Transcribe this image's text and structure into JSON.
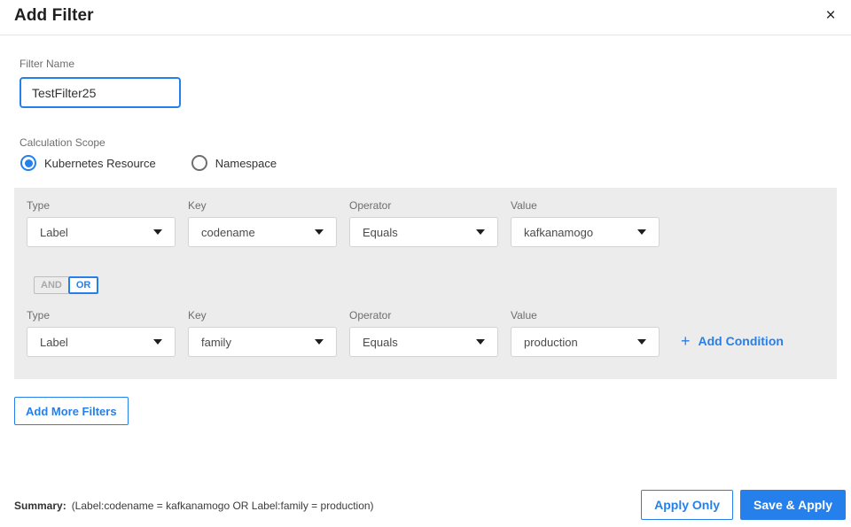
{
  "header": {
    "title": "Add Filter",
    "close_icon": "×"
  },
  "filter_name": {
    "label": "Filter Name",
    "value": "TestFilter25"
  },
  "calculation_scope": {
    "label": "Calculation Scope",
    "options": [
      {
        "label": "Kubernetes Resource",
        "selected": true
      },
      {
        "label": "Namespace",
        "selected": false
      }
    ]
  },
  "conditions": {
    "columns": [
      "Type",
      "Key",
      "Operator",
      "Value"
    ],
    "rows": [
      {
        "type": "Label",
        "key": "codename",
        "operator": "Equals",
        "value": "kafkanamogo"
      },
      {
        "type": "Label",
        "key": "family",
        "operator": "Equals",
        "value": "production"
      }
    ],
    "logic_toggle": {
      "and_label": "AND",
      "or_label": "OR",
      "selected": "OR"
    },
    "add_condition": {
      "icon": "+",
      "label": "Add Condition"
    }
  },
  "add_more_filters_label": "Add More Filters",
  "footer": {
    "summary_label": "Summary:",
    "summary_text": "(Label:codename = kafkanamogo OR Label:family = production)",
    "apply_only_label": "Apply Only",
    "save_apply_label": "Save & Apply"
  },
  "colors": {
    "accent": "#2680eb",
    "panel_bg": "#ececec"
  }
}
